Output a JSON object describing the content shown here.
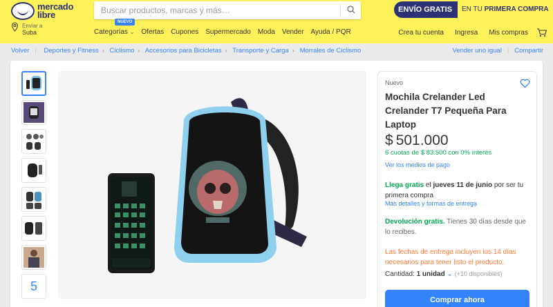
{
  "header": {
    "logo_line1": "mercado",
    "logo_line2": "libre",
    "search_placeholder": "Buscar productos, marcas y más…",
    "promo_dark": "ENVÍO GRATIS",
    "promo_light_prefix": "EN TU ",
    "promo_light_bold": "PRIMERA COMPRA",
    "location_label": "Enviar a",
    "location_value": "Suba",
    "nav": [
      "Categorías",
      "Ofertas",
      "Cupones",
      "Supermercado",
      "Moda",
      "Vender",
      "Ayuda / PQR"
    ],
    "nav_badge": "NUEVO",
    "user_nav": [
      "Crea tu cuenta",
      "Ingresa",
      "Mis compras"
    ],
    "brand_color": "#fff159",
    "brand_dark": "#2d3277"
  },
  "breadcrumb": {
    "back": "Volver",
    "items": [
      "Deportes y Fitness",
      "Ciclismo",
      "Accesorios para Bicicletas",
      "Transporte y Carga",
      "Morrales de Ciclismo"
    ],
    "sell_similar": "Vender uno igual",
    "share": "Compartir"
  },
  "gallery": {
    "thumb_count_label": "5"
  },
  "product": {
    "condition": "Nuevo",
    "title": "Mochila Crelander Led Crelander T7 Pequeña Para Laptop",
    "currency": "$",
    "price": "501.000",
    "installments": "6 cuotas de $ 83.500 con 0% interés",
    "payment_link": "Ver los medios de pago",
    "shipping_green": "Llega gratis",
    "shipping_date_prefix": " el ",
    "shipping_date": "jueves 11 de junio",
    "shipping_rest": " por ser tu primera compra",
    "shipping_link": "Más detalles y formas de entrega",
    "return_green": "Devolución gratis.",
    "return_text": " Tienes 30 días desde que lo recibes.",
    "delivery_notice": "Las fechas de entrega incluyen los 14 días necesarios para tener listo el producto.",
    "qty_label": "Cantidad: ",
    "qty_value": "1 unidad",
    "qty_available": "(+10 disponibles)",
    "buy_button": "Comprar ahora"
  },
  "colors": {
    "accent": "#3483fa",
    "green": "#00a650",
    "warning": "#ff7733"
  }
}
